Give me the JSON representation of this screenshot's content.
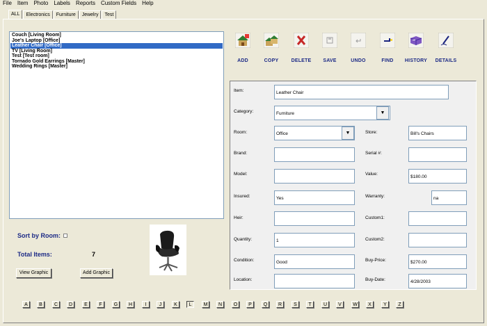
{
  "menu": [
    "File",
    "Item",
    "Photo",
    "Labels",
    "Reports",
    "Custom Fields",
    "Help"
  ],
  "tabs": [
    "ALL",
    "Electronics",
    "Furniture",
    "Jewelry",
    "Test"
  ],
  "items": [
    "Couch [Living Room]",
    "Joe's Laptop [Office]",
    "Leather Chair [Office]",
    "TV [Living Room]",
    "Test [Test room]",
    "Tornado Gold Earrings [Master]",
    "Wedding Rings [Master]"
  ],
  "selected_item_index": 2,
  "toolbar": {
    "add": "ADD",
    "copy": "COPY",
    "delete": "DELETE",
    "save": "SAVE",
    "undo": "UNDO",
    "find": "FIND",
    "history": "HISTORY",
    "details": "DETAILS"
  },
  "form": {
    "item_label": "Item:",
    "item_value": "Leather Chair",
    "category_label": "Category:",
    "category_value": "Furniture",
    "room_label": "Room:",
    "room_value": "Office",
    "store_label": "Store:",
    "store_value": "Bill's Chairs",
    "brand_label": "Brand:",
    "brand_value": "",
    "serial_label": "Serial #:",
    "serial_value": "",
    "model_label": "Model:",
    "model_value": "",
    "value_label": "Value:",
    "value_value": "$180.00",
    "insured_label": "Insured:",
    "insured_value": "Yes",
    "warranty_label": "Warranty:",
    "warranty_value": "na",
    "heir_label": "Heir:",
    "heir_value": "",
    "custom1_label": "Custom1:",
    "custom1_value": "",
    "quantity_label": "Quantity:",
    "quantity_value": "1",
    "custom2_label": "Custom2:",
    "custom2_value": "",
    "condition_label": "Condition:",
    "condition_value": "Good",
    "buy_price_label": "Buy-Price:",
    "buy_price_value": "$270.00",
    "location_label": "Location:",
    "location_value": "",
    "buy_date_label": "Buy-Date:",
    "buy_date_value": "4/28/2003"
  },
  "sort_label": "Sort by Room:",
  "total_label": "Total Items:",
  "total_value": "7",
  "view_graphic": "View Graphic",
  "add_graphic": "Add Graphic",
  "alphabet": [
    "A",
    "B",
    "C",
    "D",
    "E",
    "F",
    "G",
    "H",
    "I",
    "J",
    "K",
    "L",
    "M",
    "N",
    "O",
    "P",
    "Q",
    "R",
    "S",
    "T",
    "U",
    "V",
    "W",
    "X",
    "Y",
    "Z"
  ],
  "pressed_letter": "L",
  "colors": {
    "label_blue": "#1c2a86",
    "selection": "#316ac5"
  }
}
